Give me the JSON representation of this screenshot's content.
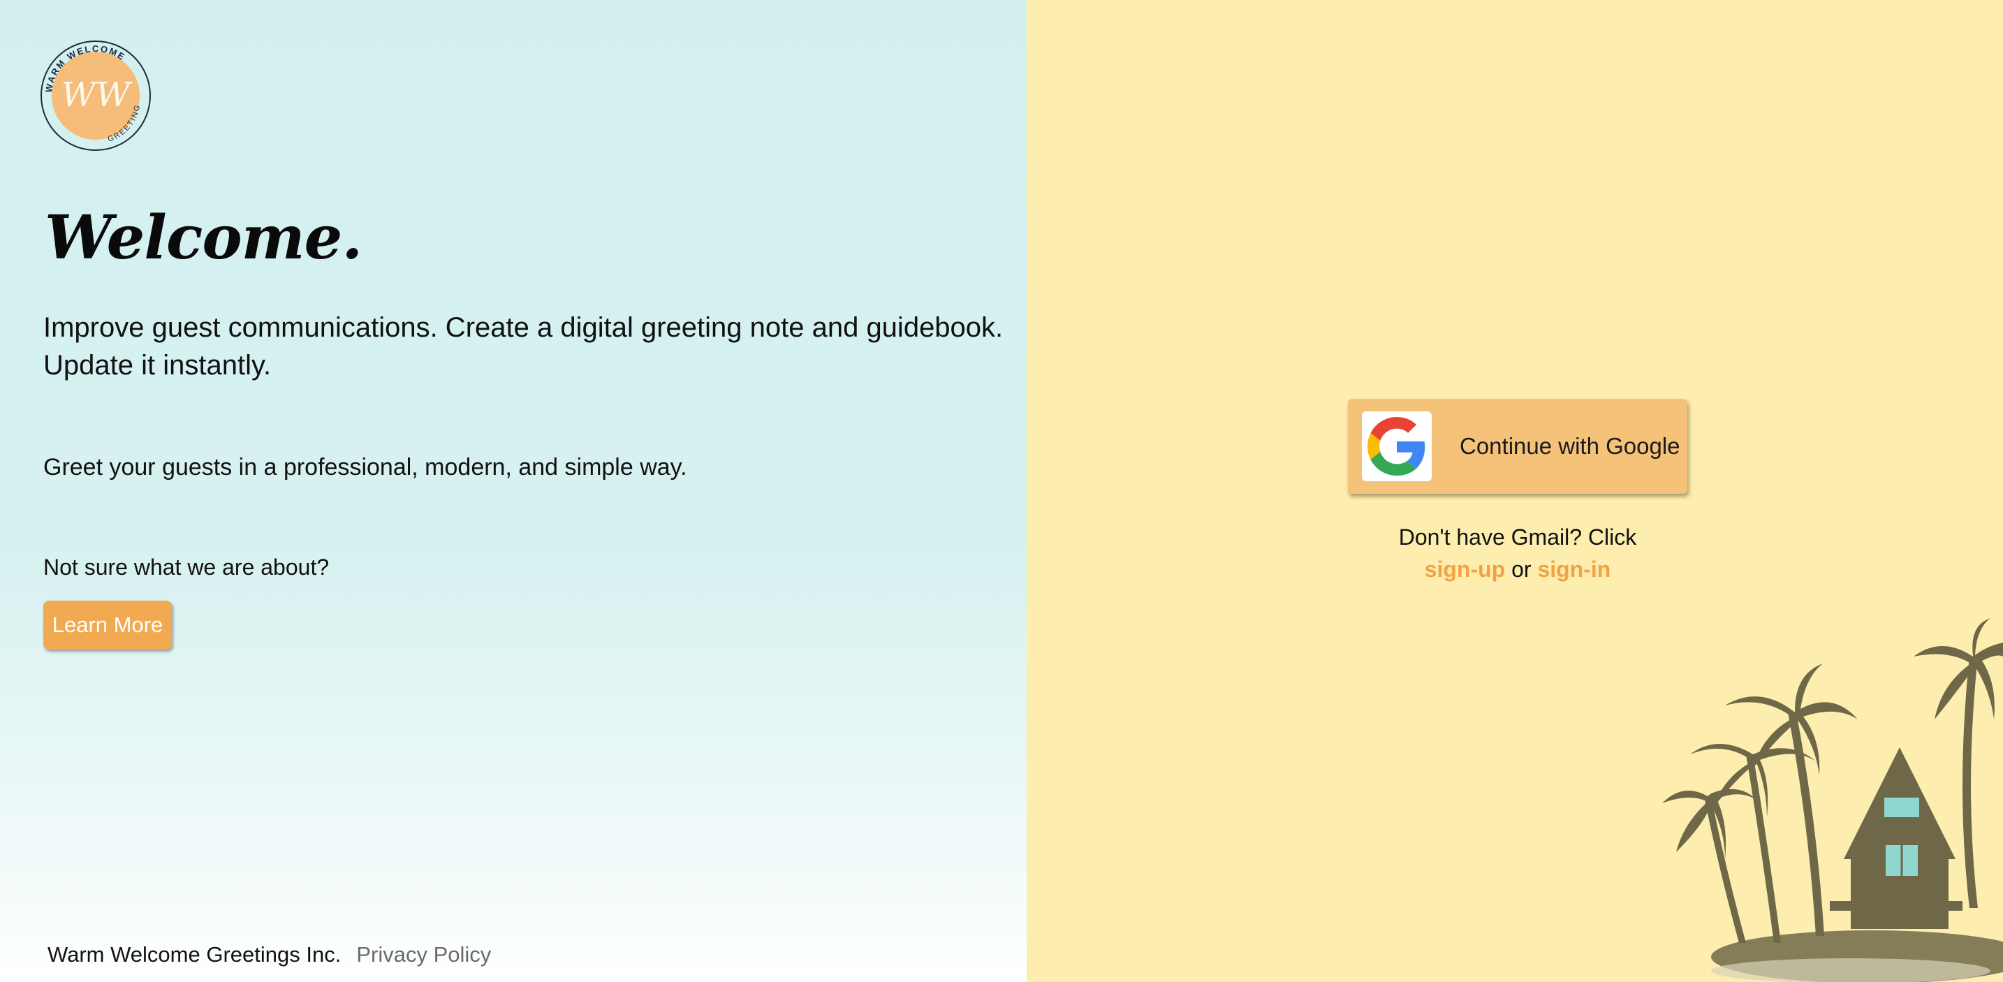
{
  "brand": {
    "logo_ring_text_top": "WARM WELCOME",
    "logo_ring_text_bottom": "GREETINGS",
    "logo_monogram": "WW"
  },
  "hero": {
    "title": "Welcome.",
    "intro": "Improve guest communications. Create a digital greeting note and guidebook. Update it instantly.",
    "tagline": "Greet your guests in a professional, modern, and simple way.",
    "question": "Not sure what we are about?",
    "learn_more_label": "Learn More"
  },
  "footer": {
    "company": "Warm Welcome Greetings Inc.",
    "privacy_label": "Privacy Policy"
  },
  "auth": {
    "google_label": "Continue with Google",
    "alt_prompt": "Don't have Gmail? Click",
    "signup_label": "sign-up",
    "or_label": "or",
    "signin_label": "sign-in"
  },
  "icons": {
    "google": "google-g-icon",
    "logo": "warm-welcome-logo",
    "illustration": "island-hut-palm-trees"
  },
  "colors": {
    "left_bg": "#d3f0ef",
    "right_bg": "#fdedae",
    "accent_orange": "#f2aa52",
    "google_button": "#f5c27a",
    "link_orange": "#f2a244",
    "silhouette": "#6e6848"
  }
}
